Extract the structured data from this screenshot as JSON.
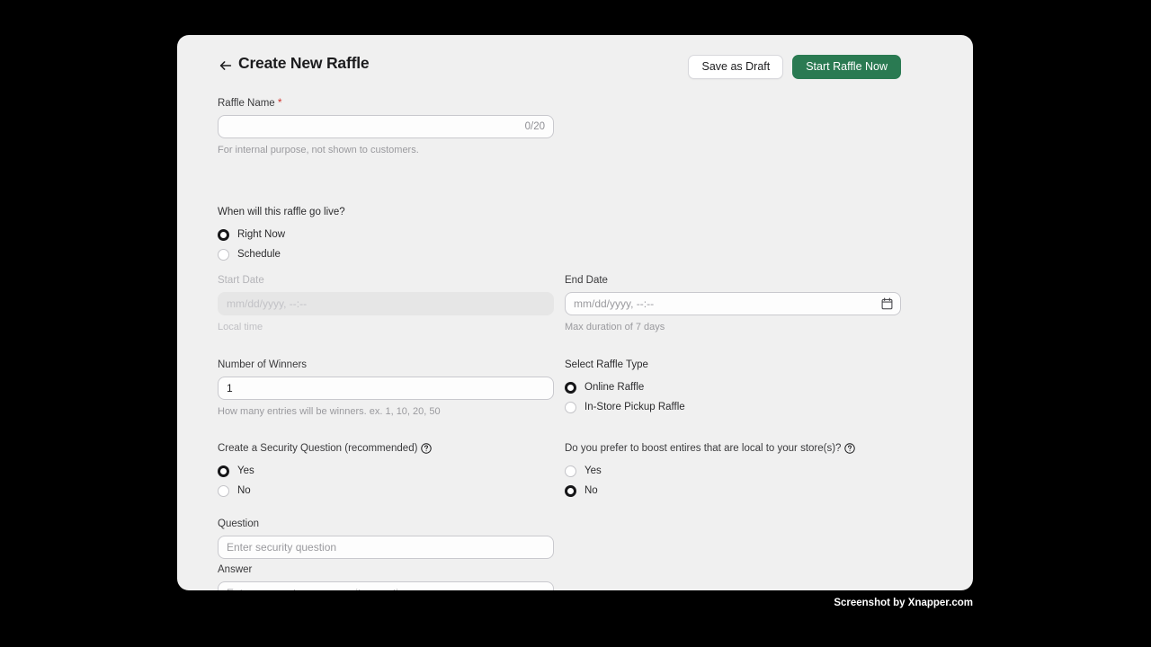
{
  "header": {
    "back_icon": "arrow-left-icon",
    "title": "Create New Raffle",
    "save_draft_label": "Save as Draft",
    "start_now_label": "Start Raffle Now",
    "primary_color": "#2a7a52"
  },
  "form": {
    "raffle_name": {
      "label": "Raffle Name",
      "required_mark": "*",
      "value": "",
      "placeholder": "",
      "counter": "0/20",
      "helper": "For internal purpose, not shown to customers."
    },
    "go_live": {
      "label": "When will this raffle go live?",
      "options": [
        {
          "label": "Right Now",
          "selected": true
        },
        {
          "label": "Schedule",
          "selected": false
        }
      ]
    },
    "start_date": {
      "label": "Start Date",
      "value": "",
      "placeholder": "mm/dd/yyyy, --:--",
      "helper": "Local time",
      "disabled": true
    },
    "end_date": {
      "label": "End Date",
      "value": "",
      "placeholder": "mm/dd/yyyy, --:--",
      "helper": "Max duration of 7 days",
      "icon": "calendar-icon",
      "disabled": false
    },
    "number_of_winners": {
      "label": "Number of Winners",
      "value": "1",
      "helper": "How many entries will be winners. ex. 1, 10, 20, 50"
    },
    "raffle_type": {
      "label": "Select Raffle Type",
      "options": [
        {
          "label": "Online Raffle",
          "selected": true
        },
        {
          "label": "In-Store Pickup Raffle",
          "selected": false
        }
      ]
    },
    "security_question": {
      "label": "Create a Security Question (recommended)",
      "help_icon": "help-circle-icon",
      "options": [
        {
          "label": "Yes",
          "selected": true
        },
        {
          "label": "No",
          "selected": false
        }
      ]
    },
    "boost_local": {
      "label": "Do you prefer to boost entires that are local to your store(s)?",
      "help_icon": "help-circle-icon",
      "options": [
        {
          "label": "Yes",
          "selected": false
        },
        {
          "label": "No",
          "selected": true
        }
      ]
    },
    "question": {
      "label": "Question",
      "value": "",
      "placeholder": "Enter security question"
    },
    "answer": {
      "label": "Answer",
      "value": "",
      "placeholder": "Enter answer to your security question"
    }
  },
  "watermark": "Screenshot by Xnapper.com"
}
